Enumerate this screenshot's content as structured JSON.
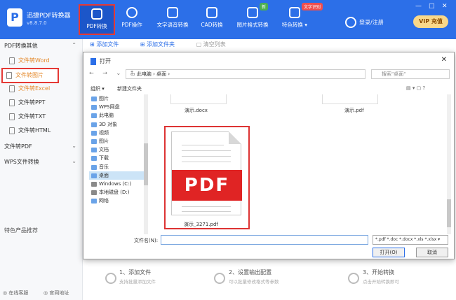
{
  "app": {
    "title": "迅捷PDF转换器",
    "version": "v8.8.7.0",
    "logo": "P"
  },
  "nav": [
    {
      "label": "PDF转换",
      "icon": "pdf-convert-icon"
    },
    {
      "label": "PDF操作",
      "icon": "pdf-operate-icon"
    },
    {
      "label": "文字语音转换",
      "icon": "voice-icon"
    },
    {
      "label": "CAD转换",
      "icon": "cad-icon"
    },
    {
      "label": "图片格式转换",
      "icon": "image-icon",
      "badge": "新"
    },
    {
      "label": "特色转换",
      "icon": "feature-icon",
      "badge": "文字识别"
    }
  ],
  "account": {
    "login": "登录/注册",
    "vip": "VIP 充值"
  },
  "window_controls": [
    "—",
    "□",
    "✕"
  ],
  "sidebar": {
    "section1": "PDF转换其他",
    "items": [
      "文件转Word",
      "文件转图片",
      "文件转Excel",
      "文件转PPT",
      "文件转TXT",
      "文件转HTML"
    ],
    "section2": "文件转PDF",
    "section3": "WPS文件转换",
    "featured": "特色产品推荐",
    "footer": {
      "service": "在线客服",
      "site": "官网地址"
    }
  },
  "toolbar": {
    "add_file": "添加文件",
    "add_folder": "添加文件夹",
    "clear": "清空列表"
  },
  "steps": [
    {
      "title": "1、添加文件",
      "sub": "支持批量添加文件"
    },
    {
      "title": "2、设置输出配置",
      "sub": "可以批量修改格式等参数"
    },
    {
      "title": "3、开始转换",
      "sub": "点击开始转换即可"
    }
  ],
  "dialog": {
    "title": "打开",
    "breadcrumb": "此电脑 › 桌面 ›",
    "search_placeholder": "搜索\"桌面\"",
    "organize": "组织 ▾",
    "new_folder": "新建文件夹",
    "tree": [
      "图片",
      "WPS网盘",
      "此电脑",
      "3D 对象",
      "视频",
      "图片",
      "文档",
      "下载",
      "音乐",
      "桌面",
      "Windows (C:)",
      "本地磁盘 (D:)",
      "网络"
    ],
    "selected_tree_item": "桌面",
    "files": {
      "top_left": "演示.docx",
      "top_right": "演示.pdf",
      "main": "演示_3271.pdf",
      "pdf_banner": "PDF"
    },
    "filename_label": "文件名(N):",
    "filename_value": "",
    "filetype": "*.pdf *.doc *.docx *.xls *.xlsx",
    "open_button": "打开(O)",
    "cancel_button": "取消"
  }
}
